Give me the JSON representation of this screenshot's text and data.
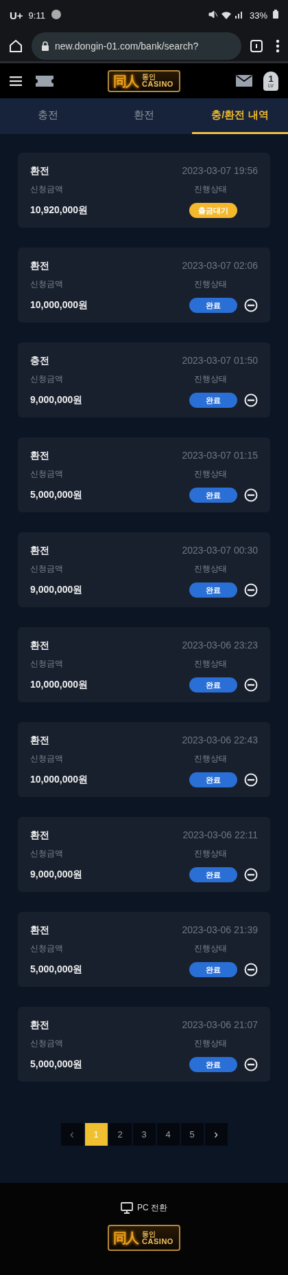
{
  "status_bar": {
    "carrier": "U+",
    "time": "9:11",
    "battery": "33%"
  },
  "browser": {
    "url": "new.dongin-01.com/bank/search?"
  },
  "header": {
    "logo": {
      "mark": "同人",
      "name": "동인",
      "sub": "CASINO"
    },
    "level": "1",
    "level_label": "LV"
  },
  "tabs": [
    {
      "label": "충전",
      "selected": false
    },
    {
      "label": "환전",
      "selected": false
    },
    {
      "label": "충/환전 내역",
      "selected": true
    }
  ],
  "transactions": [
    {
      "type": "환전",
      "date": "2023-03-07 19:56",
      "amount_label": "신청금액",
      "amount": "10,920,000원",
      "status_label": "진행상태",
      "status": "출금대기",
      "kind": "pending"
    },
    {
      "type": "환전",
      "date": "2023-03-07 02:06",
      "amount_label": "신청금액",
      "amount": "10,000,000원",
      "status_label": "진행상태",
      "status": "완료",
      "kind": "done"
    },
    {
      "type": "충전",
      "date": "2023-03-07 01:50",
      "amount_label": "신청금액",
      "amount": "9,000,000원",
      "status_label": "진행상태",
      "status": "완료",
      "kind": "done"
    },
    {
      "type": "환전",
      "date": "2023-03-07 01:15",
      "amount_label": "신청금액",
      "amount": "5,000,000원",
      "status_label": "진행상태",
      "status": "완료",
      "kind": "done"
    },
    {
      "type": "환전",
      "date": "2023-03-07 00:30",
      "amount_label": "신청금액",
      "amount": "9,000,000원",
      "status_label": "진행상태",
      "status": "완료",
      "kind": "done"
    },
    {
      "type": "환전",
      "date": "2023-03-06 23:23",
      "amount_label": "신청금액",
      "amount": "10,000,000원",
      "status_label": "진행상태",
      "status": "완료",
      "kind": "done"
    },
    {
      "type": "환전",
      "date": "2023-03-06 22:43",
      "amount_label": "신청금액",
      "amount": "10,000,000원",
      "status_label": "진행상태",
      "status": "완료",
      "kind": "done"
    },
    {
      "type": "환전",
      "date": "2023-03-06 22:11",
      "amount_label": "신청금액",
      "amount": "9,000,000원",
      "status_label": "진행상태",
      "status": "완료",
      "kind": "done"
    },
    {
      "type": "환전",
      "date": "2023-03-06 21:39",
      "amount_label": "신청금액",
      "amount": "5,000,000원",
      "status_label": "진행상태",
      "status": "완료",
      "kind": "done"
    },
    {
      "type": "환전",
      "date": "2023-03-06 21:07",
      "amount_label": "신청금액",
      "amount": "5,000,000원",
      "status_label": "진행상태",
      "status": "완료",
      "kind": "done"
    }
  ],
  "pagination": {
    "prev": "‹",
    "next": "›",
    "pages": [
      {
        "label": "1",
        "selected": true
      },
      {
        "label": "2",
        "selected": false
      },
      {
        "label": "3",
        "selected": false
      },
      {
        "label": "4",
        "selected": false
      },
      {
        "label": "5",
        "selected": false
      }
    ]
  },
  "footer": {
    "pc_switch": "PC 전환",
    "logo": {
      "mark": "同人",
      "name": "동인",
      "sub": "CASINO"
    }
  }
}
